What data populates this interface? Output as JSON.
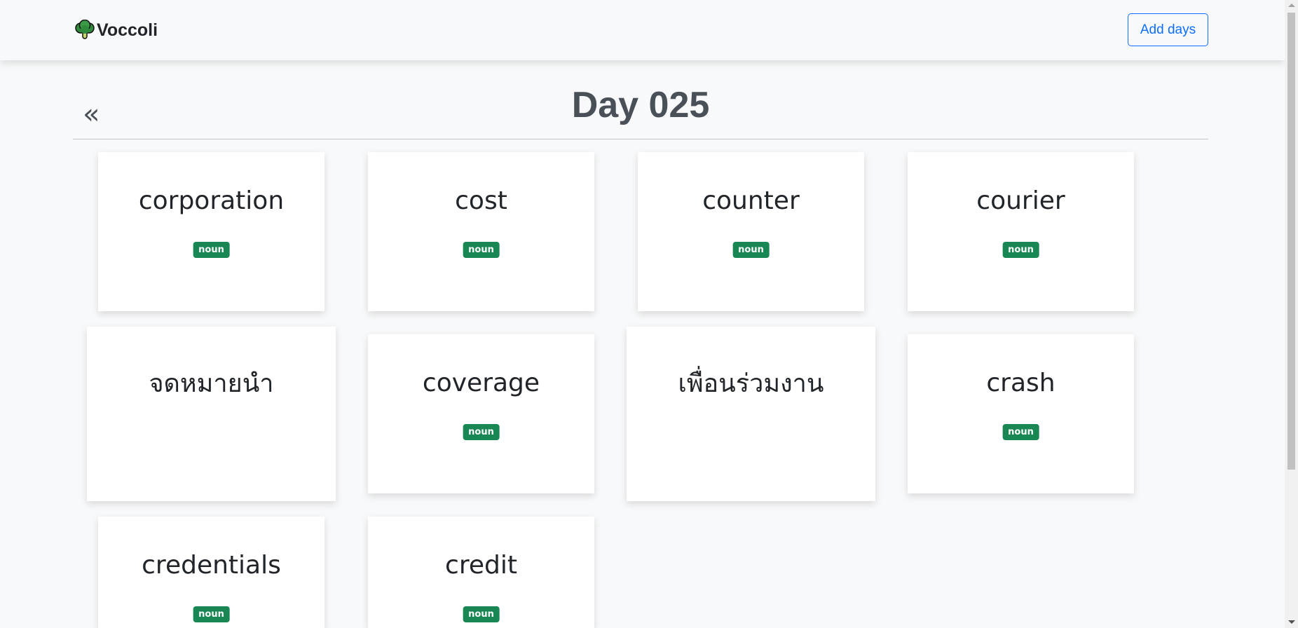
{
  "navbar": {
    "brand_name": "Voccoli",
    "brand_icon": "broccoli-icon",
    "add_days_label": "Add days"
  },
  "header": {
    "back_label": "«",
    "title": "Day 025"
  },
  "cards": [
    {
      "word": "corporation",
      "badge": "noun"
    },
    {
      "word": "cost",
      "badge": "noun"
    },
    {
      "word": "counter",
      "badge": "noun"
    },
    {
      "word": "courier",
      "badge": "noun"
    },
    {
      "word": "จดหมายนำ",
      "badge": ""
    },
    {
      "word": "coverage",
      "badge": "noun"
    },
    {
      "word": "เพื่อนร่วมงาน",
      "badge": ""
    },
    {
      "word": "crash",
      "badge": "noun"
    },
    {
      "word": "credentials",
      "badge": "noun"
    },
    {
      "word": "credit",
      "badge": "noun"
    }
  ],
  "colors": {
    "accent": "#0d6efd",
    "badge": "#198754",
    "background": "#f8f9fa"
  }
}
